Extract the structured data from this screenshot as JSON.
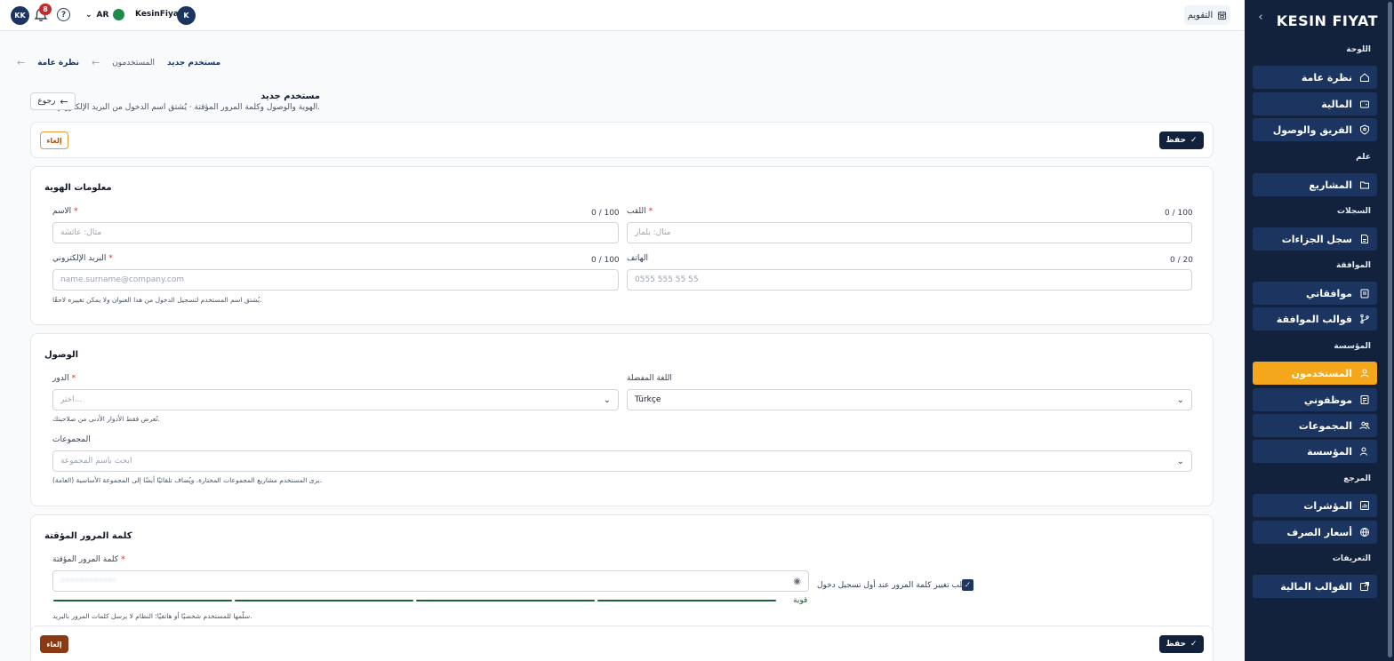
{
  "sidebar": {
    "logo": "KESIN FIYAT",
    "sections": {
      "dashboard": "اللوحة",
      "general": "علم",
      "records": "السجلات",
      "approval": "الموافقة",
      "organization": "المؤسسة",
      "reference": "المرجع",
      "definitions": "التعريفات"
    },
    "items": {
      "overview": "نظرة عامة",
      "finance": "المالية",
      "team": "الفريق والوصول",
      "projects": "المشاريع",
      "penalties": "سجل الجزاءات",
      "my_approvals": "موافقاتي",
      "approval_templates": "قوالب الموافقة",
      "users": "المستخدمون",
      "my_employees": "موظفوني",
      "groups": "المجموعات",
      "institution": "المؤسسة",
      "indicators": "المؤشرات",
      "exchange_rates": "أسعار الصرف",
      "financial_templates": "القوالب المالية"
    }
  },
  "topbar": {
    "user_initials": "KK",
    "notification_count": "8",
    "help": "?",
    "language": "AR",
    "username": "KesinFiyat",
    "username_initial": "K",
    "calendar_label": "التقويم"
  },
  "breadcrumb": {
    "home": "نظرة عامة",
    "users": "المستخدمون",
    "current": "مستخدم جديد"
  },
  "page": {
    "title": "مستخدم جديد",
    "subtitle": "الهوية والوصول وكلمة المرور المؤقتة · يُشتق اسم الدخول من البريد الإلكتروني.",
    "back": "رجوع",
    "save": "حفظ",
    "cancel": "إلغاء"
  },
  "identity": {
    "title": "معلومات الهوية",
    "first_name_label": "الاسم",
    "first_name_counter": "0 / 100",
    "first_name_placeholder": "مثال: عائشة",
    "last_name_label": "اللقب",
    "last_name_counter": "0 / 100",
    "last_name_placeholder": "مثال: يلماز",
    "email_label": "البريد الإلكتروني",
    "email_counter": "0 / 100",
    "email_placeholder": "name.surname@company.com",
    "phone_label": "الهاتف",
    "phone_counter": "0 / 20",
    "phone_placeholder": "0555 555 55 55",
    "email_hint": "يُشتق اسم المستخدم لتسجيل الدخول من هذا العنوان ولا يمكن تغييره لاحقًا."
  },
  "access": {
    "title": "الوصول",
    "role_label": "الدور",
    "role_placeholder": "اختر...",
    "role_hint": "تُعرض فقط الأدوار الأدنى من صلاحيتك.",
    "language_label": "اللغة المفضلة",
    "language_value": "Türkçe",
    "groups_label": "المجموعات",
    "groups_placeholder": "ابحث باسم المجموعة",
    "groups_hint": "يرى المستخدم مشاريع المجموعات المختارة. ويُضاف تلقائيًا أيضًا إلى المجموعة الأساسية (العامة)."
  },
  "password": {
    "title": "كلمة المرور المؤقتة",
    "label": "كلمة المرور المؤقتة",
    "value": "••••••••••••",
    "strength": 1.0,
    "strength_label": "قوية",
    "hint": "سلّمها للمستخدم شخصيًا أو هاتفيًا؛ النظام لا يرسل كلمات المرور بالبريد.",
    "force_change_label": "طلب تغيير كلمة المرور عند أول تسجيل دخول",
    "force_change": true
  },
  "colors": {
    "sidebar_bg": "#13223c",
    "sidebar_item": "#1b3560",
    "active_accent": "#f4a71b",
    "strength_green": "#1f5f3a",
    "cancel_brown": "#8a3a12"
  }
}
